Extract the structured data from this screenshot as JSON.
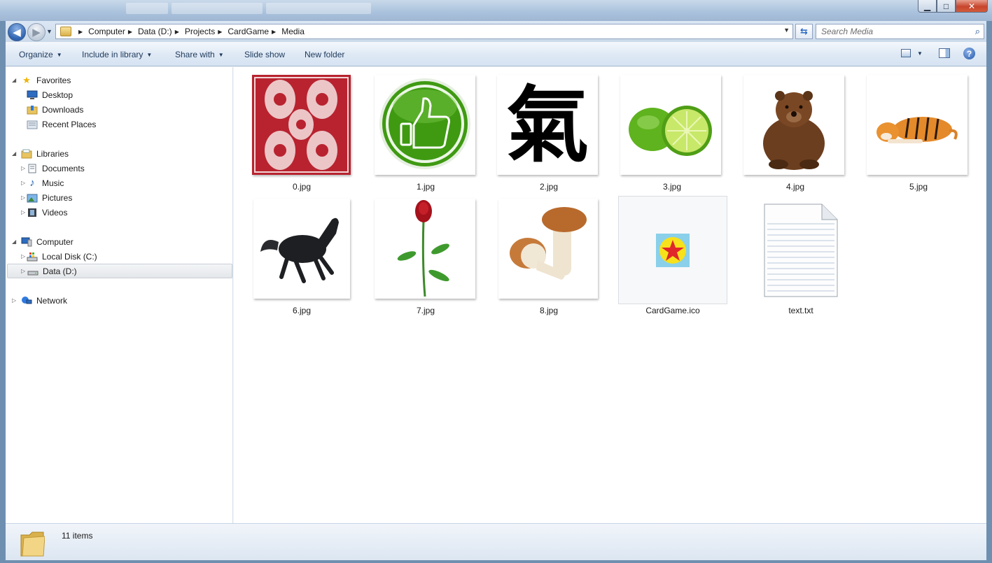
{
  "window": {
    "minimize_glyph": "▁",
    "maximize_glyph": "□",
    "close_glyph": "✕"
  },
  "address": {
    "crumbs": [
      "Computer",
      "Data (D:)",
      "Projects",
      "CardGame",
      "Media"
    ]
  },
  "search": {
    "placeholder": "Search Media"
  },
  "toolbar": {
    "organize_label": "Organize",
    "include_label": "Include in library",
    "share_label": "Share with",
    "slideshow_label": "Slide show",
    "new_folder_label": "New folder",
    "help_glyph": "?"
  },
  "sidebar": {
    "favorites_label": "Favorites",
    "favorites": [
      "Desktop",
      "Downloads",
      "Recent Places"
    ],
    "libraries_label": "Libraries",
    "libraries": [
      "Documents",
      "Music",
      "Pictures",
      "Videos"
    ],
    "computer_label": "Computer",
    "drives": [
      "Local Disk (C:)",
      "Data (D:)"
    ],
    "network_label": "Network",
    "selected": "Data (D:)"
  },
  "files": [
    {
      "name": "0.jpg",
      "icon": "card-back-image"
    },
    {
      "name": "1.jpg",
      "icon": "thumbs-up-image"
    },
    {
      "name": "2.jpg",
      "icon": "kanji-image",
      "glyph": "氣"
    },
    {
      "name": "3.jpg",
      "icon": "lime-image"
    },
    {
      "name": "4.jpg",
      "icon": "bear-image"
    },
    {
      "name": "5.jpg",
      "icon": "tiger-image"
    },
    {
      "name": "6.jpg",
      "icon": "horse-image"
    },
    {
      "name": "7.jpg",
      "icon": "rose-image"
    },
    {
      "name": "8.jpg",
      "icon": "mushroom-image"
    },
    {
      "name": "CardGame.ico",
      "icon": "star-icon-file"
    },
    {
      "name": "text.txt",
      "icon": "text-document-icon"
    }
  ],
  "status": {
    "item_count": "11 items"
  },
  "colors": {
    "titlebar": "#a9c1dc",
    "commandbar": "#dfe9f5",
    "card_red": "#b8232f",
    "thumb_green": "#3f9a12",
    "lime_green": "#5fb31e",
    "star_red": "#e0262b",
    "star_yellow": "#f7e11a",
    "ico_bg": "#8ad0ea"
  }
}
